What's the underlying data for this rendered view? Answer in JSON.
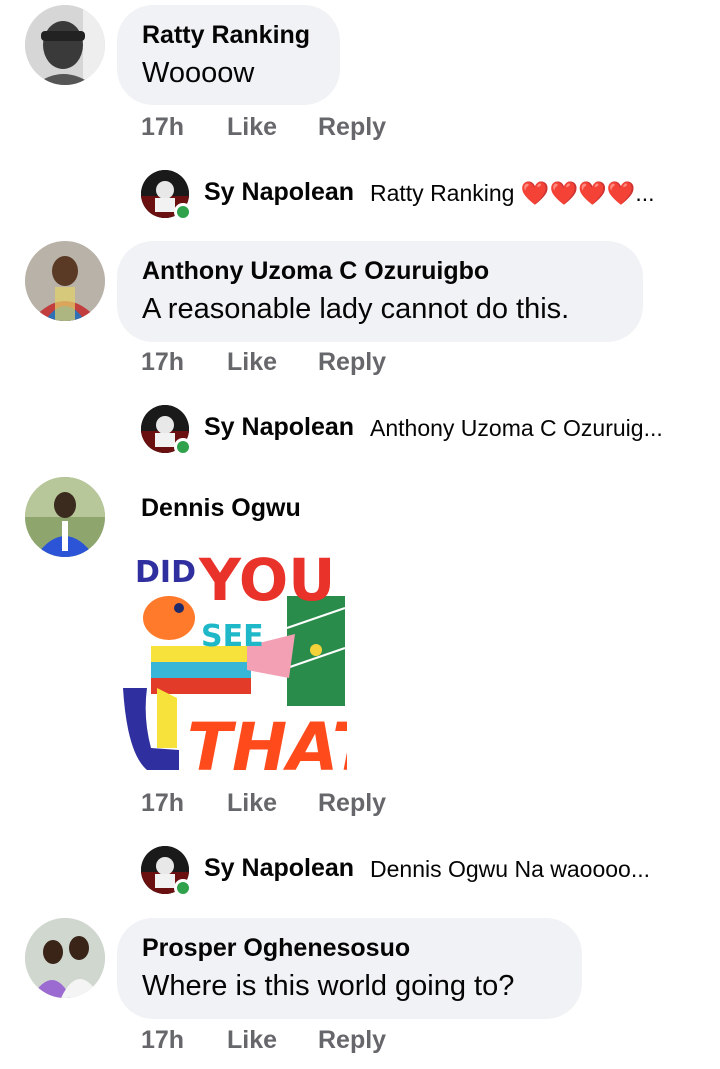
{
  "comments": [
    {
      "author": "Ratty Ranking",
      "text": "Woooow",
      "time": "17h",
      "like_label": "Like",
      "reply_label": "Reply",
      "reply_preview": {
        "author": "Sy Napolean",
        "snippet": "Ratty Ranking ❤️❤️❤️❤️..."
      }
    },
    {
      "author": "Anthony Uzoma C Ozuruigbo",
      "text": "A reasonable lady cannot do this.",
      "time": "17h",
      "like_label": "Like",
      "reply_label": "Reply",
      "reply_preview": {
        "author": "Sy Napolean",
        "snippet": "Anthony Uzoma C Ozuruig..."
      }
    },
    {
      "author": "Dennis Ogwu",
      "sticker": {
        "words": [
          "DID",
          "YOU",
          "SEE",
          "THAT?"
        ]
      },
      "time": "17h",
      "like_label": "Like",
      "reply_label": "Reply",
      "reply_preview": {
        "author": "Sy Napolean",
        "snippet": "Dennis Ogwu Na waoooo..."
      }
    },
    {
      "author": "Prosper Oghenesosuo",
      "text": "Where is this world going to?",
      "time": "17h",
      "like_label": "Like",
      "reply_label": "Reply"
    }
  ],
  "colors": {
    "bubble_bg": "#f0f2f5",
    "meta_text": "#65676b",
    "online_green": "#31a24c"
  }
}
